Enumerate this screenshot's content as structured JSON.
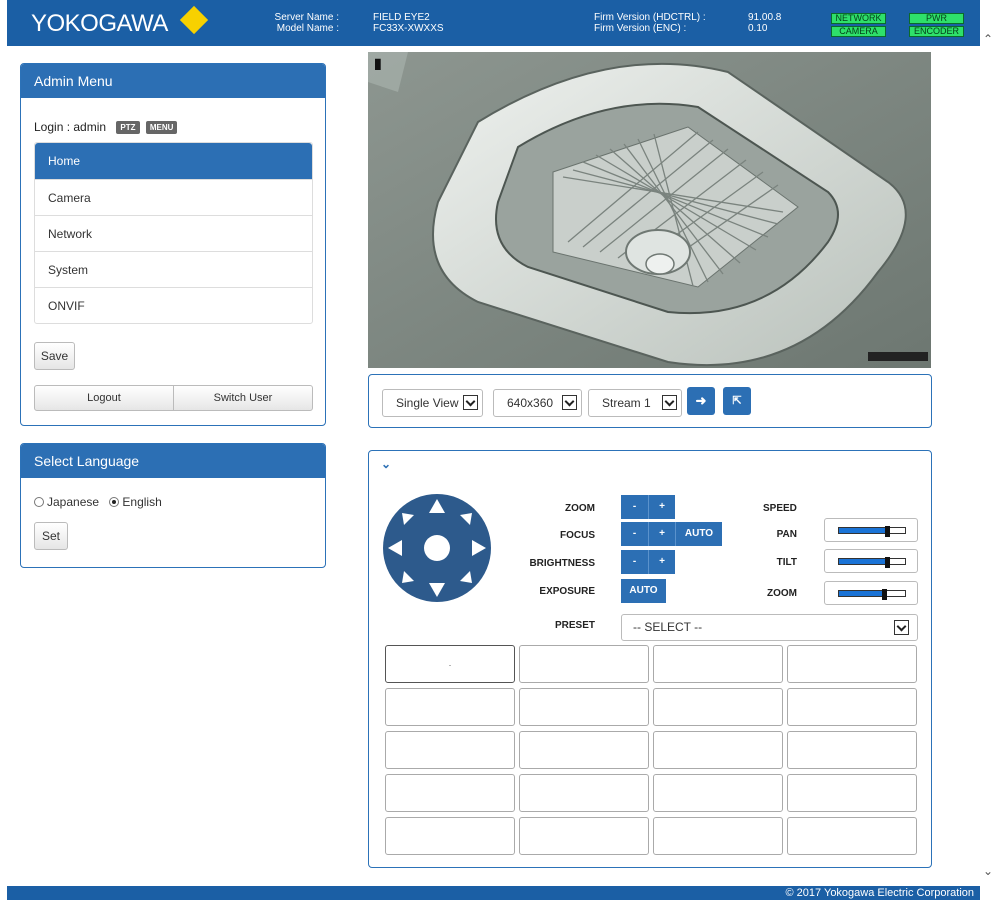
{
  "header": {
    "logo": "YOKOGAWA",
    "server_name_label": "Server Name :",
    "model_name_label": "Model Name :",
    "server_name": "FIELD EYE2",
    "model_name": "FC33X-XWXXS",
    "firm_hdctrl_label": "Firm Version (HDCTRL) :",
    "firm_enc_label": "Firm Version (ENC) :",
    "firm_hdctrl": "91.00.8",
    "firm_enc": "0.10",
    "status": {
      "network": "NETWORK",
      "pwr": "PWR",
      "camera": "CAMERA",
      "encoder": "ENCODER"
    },
    "brand_color": "#1b5fa5",
    "accent_color": "#f7d100",
    "status_color": "#2ee06a"
  },
  "admin": {
    "title": "Admin Menu",
    "login_text": "Login : admin",
    "tag_ptz": "PTZ",
    "tag_menu": "MENU",
    "items": [
      {
        "label": "Home",
        "active": true
      },
      {
        "label": "Camera"
      },
      {
        "label": "Network"
      },
      {
        "label": "System"
      },
      {
        "label": "ONVIF"
      }
    ],
    "save": "Save",
    "logout": "Logout",
    "switch_user": "Switch User"
  },
  "language": {
    "title": "Select Language",
    "japanese": "Japanese",
    "english": "English",
    "selected": "English",
    "set": "Set"
  },
  "camera": {
    "overlay_icon": "camera-marker-icon",
    "timestamp_badge": "timestamp-overlay"
  },
  "toolbar": {
    "view": "Single View",
    "resolution": "640x360",
    "stream": "Stream 1",
    "goto_icon": "arrow-forward-icon",
    "fullscreen_icon": "fullscreen-icon"
  },
  "ptz": {
    "collapse_icon": "chevron-down-icon",
    "zoom": "ZOOM",
    "focus": "FOCUS",
    "brightness": "BRIGHTNESS",
    "exposure": "EXPOSURE",
    "preset": "PRESET",
    "minus": "-",
    "plus": "+",
    "auto": "AUTO",
    "speed": "SPEED",
    "pan": "PAN",
    "tilt": "TILT",
    "speed_zoom": "ZOOM",
    "pan_level": 0.7,
    "tilt_level": 0.7,
    "zoom_level": 0.65,
    "preset_select": "-- SELECT --",
    "preset_first": "."
  },
  "footer": {
    "copyright": "© 2017 Yokogawa Electric Corporation"
  }
}
